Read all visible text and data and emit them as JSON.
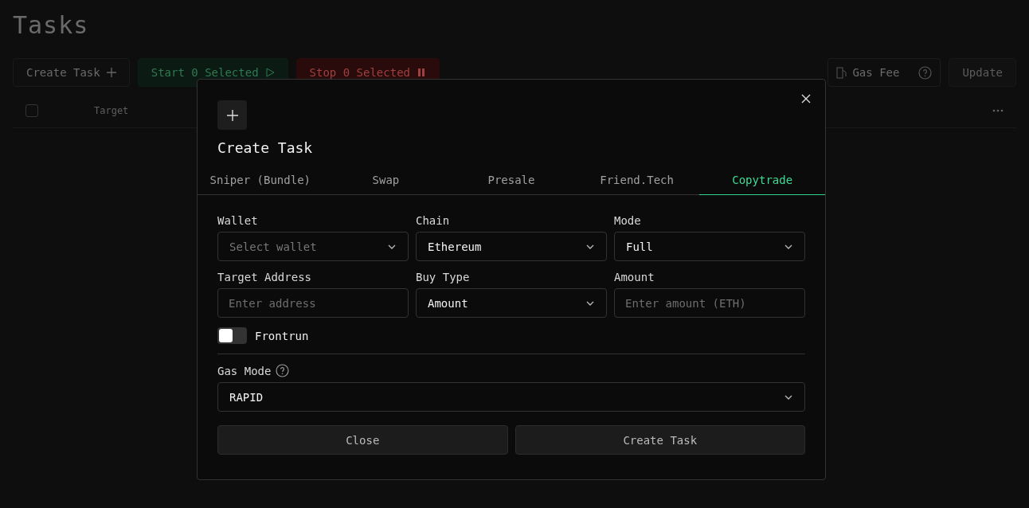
{
  "page": {
    "title": "Tasks"
  },
  "toolbar": [
    {
      "label": "Create Task",
      "kind": "create"
    },
    {
      "label": "Start 0 Selected",
      "kind": "start"
    },
    {
      "label": "Stop 0 Selected",
      "kind": "stop"
    }
  ],
  "gas_fee": {
    "label": "Gas Fee"
  },
  "update_button": {
    "label": "Update"
  },
  "table": {
    "columns": [
      "Target"
    ],
    "select_all": {
      "checked": false
    }
  },
  "dialog": {
    "title": "Create Task",
    "tabs": [
      {
        "label": "Sniper (Bundle)",
        "selected": false
      },
      {
        "label": "Swap",
        "selected": false
      },
      {
        "label": "Presale",
        "selected": false
      },
      {
        "label": "Friend.Tech",
        "selected": false
      },
      {
        "label": "Copytrade",
        "selected": true
      }
    ],
    "fields": [
      {
        "label": "Wallet",
        "kind": "select",
        "placeholder": "Select wallet"
      },
      {
        "label": "Chain",
        "kind": "select",
        "value": "Ethereum"
      },
      {
        "label": "Mode",
        "kind": "select",
        "value": "Full"
      },
      {
        "label": "Target Address",
        "kind": "input",
        "placeholder": "Enter address"
      },
      {
        "label": "Buy Type",
        "kind": "select",
        "value": "Amount"
      },
      {
        "label": "Amount",
        "kind": "input",
        "placeholder": "Enter amount (ETH)"
      }
    ],
    "frontrun": {
      "label": "Frontrun",
      "on": false
    },
    "gas_mode": {
      "label": "Gas Mode",
      "value": "RAPID"
    },
    "buttons": [
      "Close",
      "Create Task"
    ]
  }
}
